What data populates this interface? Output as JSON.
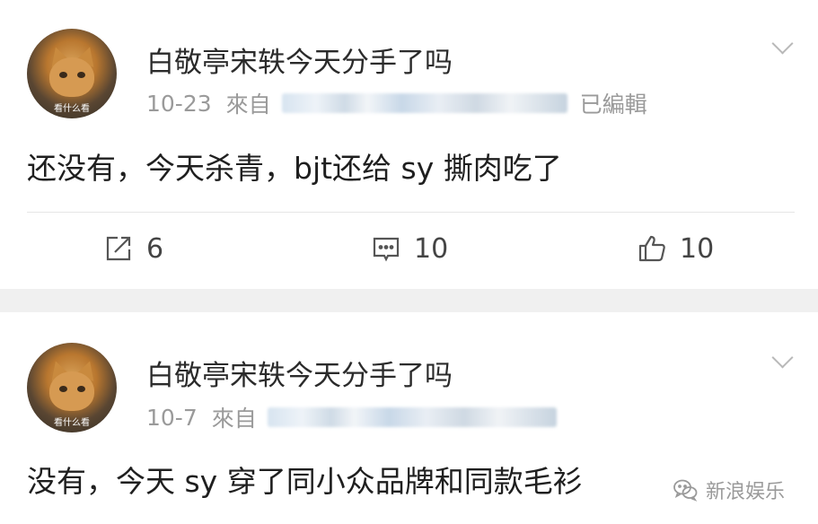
{
  "posts": [
    {
      "avatar_caption": "看什么看",
      "username": "白敬亭宋轶今天分手了吗",
      "date": "10-23",
      "source_prefix": "來自",
      "edited": "已編輯",
      "text": "还没有，今天杀青，bjt还给 sy 撕肉吃了",
      "actions": {
        "repost_count": "6",
        "comment_count": "10",
        "like_count": "10"
      }
    },
    {
      "avatar_caption": "看什么看",
      "username": "白敬亭宋轶今天分手了吗",
      "date": "10-7",
      "source_prefix": "來自",
      "text": "没有，今天 sy 穿了同小众品牌和同款毛衫"
    }
  ],
  "watermark": {
    "text": "新浪娱乐",
    "icon": "wechat-icon"
  },
  "colors": {
    "separator": "#f0f0f0",
    "meta_text": "#9a9a9a",
    "body_text": "#1f1f1f"
  }
}
